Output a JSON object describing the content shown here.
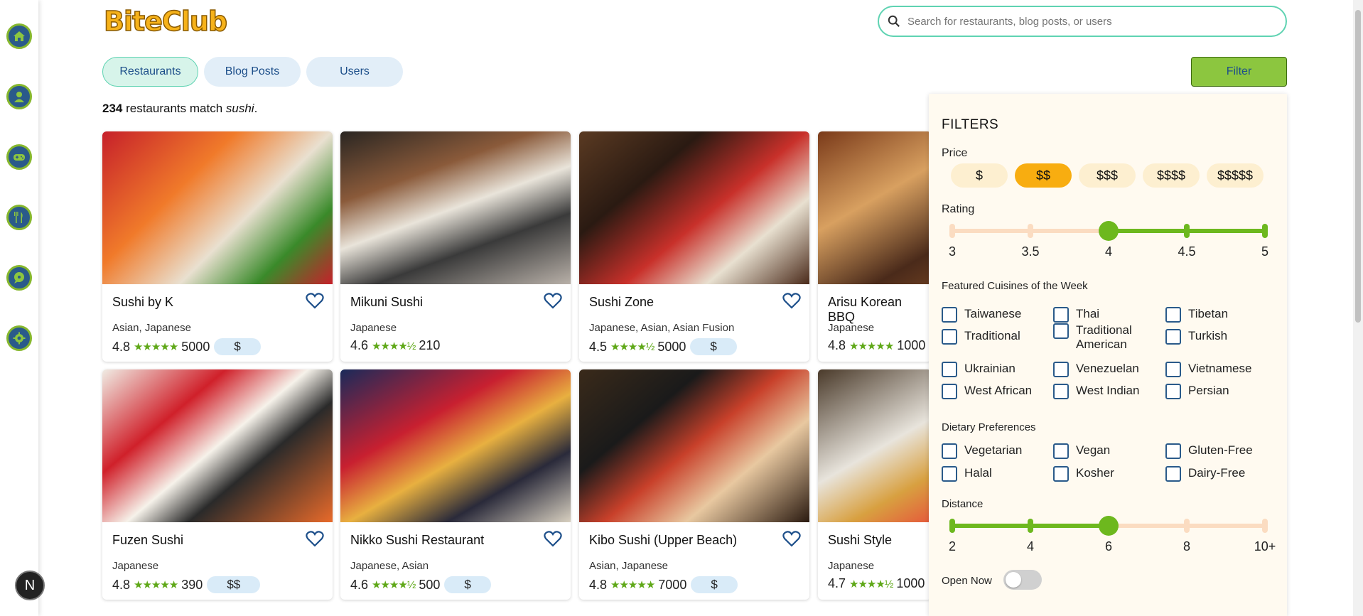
{
  "app": {
    "logo": "BiteClub"
  },
  "search": {
    "placeholder": "Search for restaurants, blog posts, or users"
  },
  "tabs": [
    {
      "label": "Restaurants",
      "active": true
    },
    {
      "label": "Blog Posts",
      "active": false
    },
    {
      "label": "Users",
      "active": false
    }
  ],
  "filter_button": "Filter",
  "results": {
    "count": "234",
    "text": " restaurants match ",
    "query": "sushi",
    "end": "."
  },
  "sidebar": {
    "icons": [
      "home-icon",
      "profile-icon",
      "games-icon",
      "food-icon",
      "chat-icon",
      "settings-icon"
    ],
    "badge": "N"
  },
  "restaurants": [
    {
      "name": "Sushi by K",
      "cuisines": "Asian, Japanese",
      "rating": "4.8",
      "stars": "★★★★★",
      "reviews": "5000",
      "price": "$"
    },
    {
      "name": "Mikuni Sushi",
      "cuisines": "Japanese",
      "rating": "4.6",
      "stars": "★★★★½",
      "reviews": "210",
      "price": ""
    },
    {
      "name": "Sushi Zone",
      "cuisines": "Japanese, Asian, Asian Fusion",
      "rating": "4.5",
      "stars": "★★★★½",
      "reviews": "5000",
      "price": "$"
    },
    {
      "name": "Arisu Korean BBQ",
      "cuisines": "Japanese",
      "rating": "4.8",
      "stars": "★★★★★",
      "reviews": "1000",
      "price": ""
    },
    {
      "name": "Fuzen Sushi",
      "cuisines": "Japanese",
      "rating": "4.8",
      "stars": "★★★★★",
      "reviews": "390",
      "price": "$$"
    },
    {
      "name": "Nikko Sushi Restaurant",
      "cuisines": "Japanese, Asian",
      "rating": "4.6",
      "stars": "★★★★½",
      "reviews": "500",
      "price": "$"
    },
    {
      "name": "Kibo Sushi (Upper Beach)",
      "cuisines": "Asian, Japanese",
      "rating": "4.8",
      "stars": "★★★★★",
      "reviews": "7000",
      "price": "$"
    },
    {
      "name": "Sushi Style",
      "cuisines": "Japanese",
      "rating": "4.7",
      "stars": "★★★★½",
      "reviews": "1000",
      "price": ""
    }
  ],
  "filters": {
    "title": "FILTERS",
    "price_label": "Price",
    "prices": [
      "$",
      "$$",
      "$$$",
      "$$$$",
      "$$$$$"
    ],
    "price_selected": "$$",
    "rating_label": "Rating",
    "rating_ticks": [
      "3",
      "3.5",
      "4",
      "4.5",
      "5"
    ],
    "rating_selected_min": "4",
    "cuisines_label": "Featured Cuisines of the Week",
    "cuisines": [
      "Taiwanese",
      "Thai",
      "Tibetan",
      "Traditional",
      "Traditional American",
      "Turkish",
      "Ukrainian",
      "Venezuelan",
      "Vietnamese",
      "West African",
      "West Indian",
      "Persian"
    ],
    "dietary_label": "Dietary Preferences",
    "dietary": [
      "Vegetarian",
      "Vegan",
      "Gluten-Free",
      "Halal",
      "Kosher",
      "Dairy-Free"
    ],
    "distance_label": "Distance",
    "distance_ticks": [
      "2",
      "4",
      "6",
      "8",
      "10+"
    ],
    "distance_selected_max": "6",
    "open_now_label": "Open Now",
    "open_now": false
  },
  "colors": {
    "accent_green": "#8cc63f",
    "accent_teal": "#5fd3b2",
    "price_active": "#f8ad10",
    "star_green": "#5fa818"
  }
}
